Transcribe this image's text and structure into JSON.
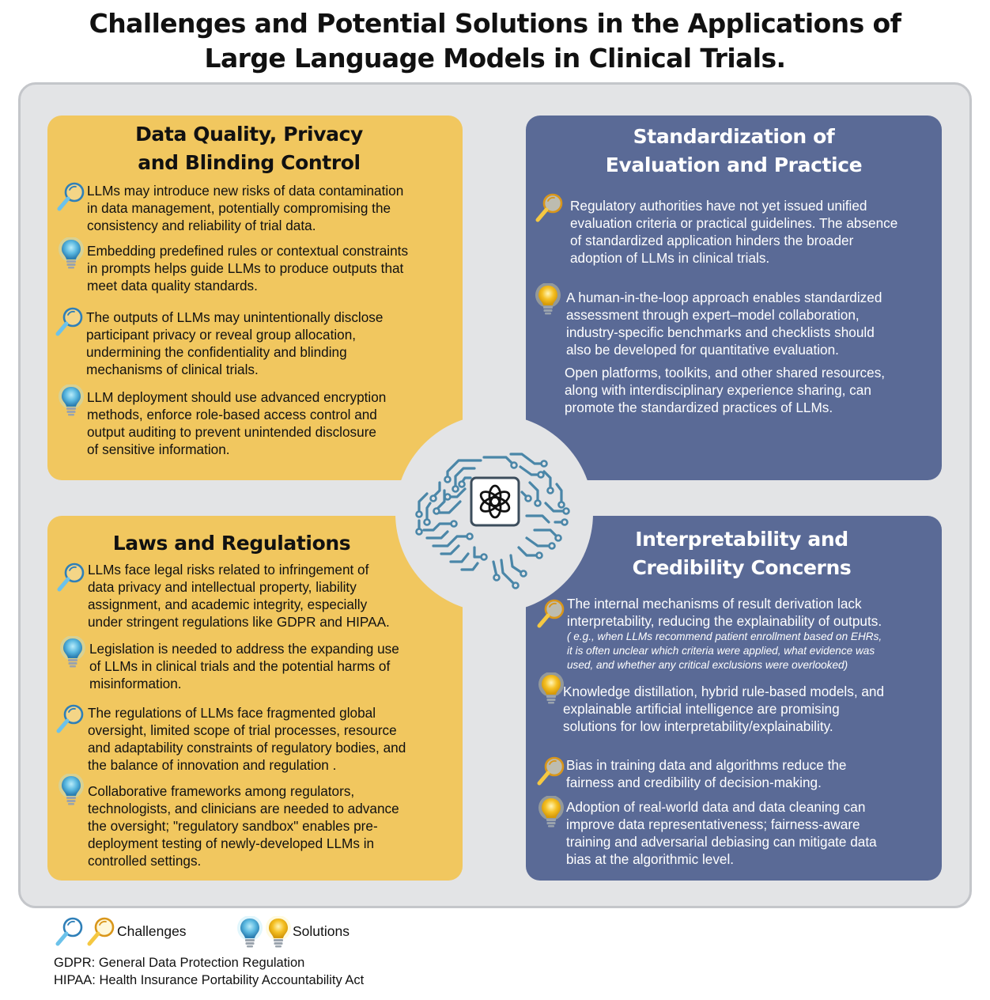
{
  "title": {
    "line1": "Challenges and Potential Solutions in the Applications of",
    "line2": "Large Language Models in Clinical Trials."
  },
  "panels": [
    {
      "heading": [
        "Data Quality, Privacy",
        "and Blinding Control"
      ],
      "items": [
        {
          "kind": "challenge",
          "lines": [
            "LLMs may introduce new risks of data contamination",
            "in data management, potentially compromising the",
            "consistency and reliability of trial data."
          ]
        },
        {
          "kind": "solution",
          "lines": [
            "Embedding predefined rules or contextual constraints",
            "in prompts helps guide LLMs to produce outputs that",
            "meet data quality standards."
          ]
        },
        {
          "kind": "challenge",
          "lines": [
            "The outputs of LLMs may unintentionally disclose",
            "participant privacy or reveal group allocation,",
            "undermining the confidentiality and blinding",
            "mechanisms of clinical trials."
          ]
        },
        {
          "kind": "solution",
          "lines": [
            "LLM deployment should use advanced encryption",
            "methods, enforce role-based access control and",
            "output auditing to prevent unintended disclosure",
            "of sensitive information."
          ]
        }
      ]
    },
    {
      "heading": [
        "Standardization of",
        "Evaluation and Practice"
      ],
      "items": [
        {
          "kind": "challenge",
          "lines": [
            "Regulatory authorities have not yet issued unified",
            "evaluation criteria or practical guidelines. The absence",
            "of standardized application hinders the broader",
            "adoption of LLMs in clinical trials."
          ]
        },
        {
          "kind": "solution",
          "lines": [
            "A human-in-the-loop approach enables standardized",
            "assessment through expert–model collaboration,",
            "industry-specific benchmarks and checklists should",
            "also be developed for quantitative evaluation."
          ]
        },
        {
          "kind": "text",
          "lines": [
            "Open platforms, toolkits, and other shared resources,",
            "along with interdisciplinary experience sharing, can",
            "promote the standardized practices of LLMs."
          ]
        }
      ]
    },
    {
      "heading": [
        "Laws and Regulations"
      ],
      "items": [
        {
          "kind": "challenge",
          "lines": [
            "LLMs face legal risks related to infringement of",
            "data privacy and intellectual property, liability",
            "assignment, and academic integrity, especially",
            "under stringent regulations like GDPR and HIPAA."
          ]
        },
        {
          "kind": "solution",
          "lines": [
            "Legislation is needed to address the expanding use",
            "of LLMs in clinical trials and the potential harms of",
            "misinformation."
          ]
        },
        {
          "kind": "challenge",
          "lines": [
            "The regulations of LLMs face fragmented global",
            "oversight, limited scope of trial processes, resource",
            "and adaptability constraints of regulatory bodies, and",
            "the balance of innovation and regulation ."
          ]
        },
        {
          "kind": "solution",
          "lines": [
            "Collaborative frameworks among regulators,",
            "technologists, and clinicians are needed to advance",
            "the oversight; \"regulatory sandbox\" enables pre-",
            "deployment testing of newly-developed LLMs in",
            "controlled settings."
          ]
        }
      ]
    },
    {
      "heading": [
        "Interpretability and",
        "Credibility Concerns"
      ],
      "items": [
        {
          "kind": "challenge",
          "lines": [
            "The internal mechanisms of result derivation lack",
            "interpretability, reducing the explainability of outputs."
          ],
          "note": [
            " ( e.g., when LLMs recommend patient enrollment based on EHRs,",
            "it is often unclear which criteria were applied, what evidence was",
            "used, and whether any critical exclusions were overlooked)"
          ]
        },
        {
          "kind": "solution",
          "lines": [
            "Knowledge distillation, hybrid rule-based models, and",
            "explainable artificial intelligence are promising",
            "solutions for low interpretability/explainability."
          ]
        },
        {
          "kind": "challenge",
          "lines": [
            "Bias in training data and algorithms reduce the",
            "fairness and credibility of decision-making."
          ]
        },
        {
          "kind": "solution",
          "lines": [
            "Adoption of real-world data and data cleaning can",
            "improve data representativeness; fairness-aware",
            "training and adversarial debiasing can mitigate data",
            "bias at the algorithmic level."
          ]
        }
      ]
    }
  ],
  "legend": {
    "challenges": "Challenges",
    "solutions": "Solutions",
    "challenge_icon": "magnifier-icon",
    "solution_icon": "lightbulb-icon"
  },
  "abbreviations": [
    "GDPR: General Data Protection Regulation",
    "HIPAA: Health Insurance Portability Accountability Act"
  ],
  "center_icon": "ai-brain-circuit-icon",
  "colors": {
    "yellow_panel": "#f1c75f",
    "blue_panel": "#5a6a96",
    "background": "#e3e4e6",
    "brain": "#4a86a8",
    "icon_blue": "#5ab8e0",
    "icon_yellow": "#f5c023"
  }
}
